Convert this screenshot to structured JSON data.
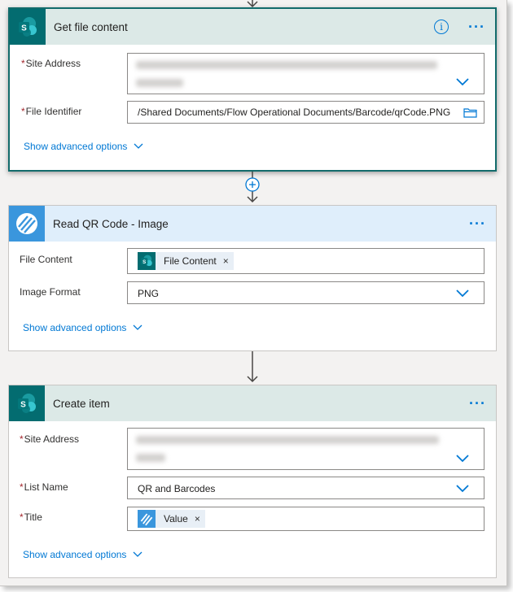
{
  "get_file_content": {
    "title": "Get file content",
    "more_icon": "more-dots-icon",
    "info_icon": "info-icon",
    "site_address": {
      "label": "Site Address",
      "required_mark": "*"
    },
    "file_identifier": {
      "label": "File Identifier",
      "required_mark": "*",
      "value": "/Shared Documents/Flow Operational Documents/Barcode/qrCode.PNG"
    },
    "advanced": "Show advanced options"
  },
  "read_qr": {
    "title": "Read QR Code - Image",
    "file_content": {
      "label": "File Content",
      "token": "File Content"
    },
    "image_format": {
      "label": "Image Format",
      "value": "PNG"
    },
    "advanced": "Show advanced options"
  },
  "create_item": {
    "title": "Create item",
    "site_address": {
      "label": "Site Address",
      "required_mark": "*"
    },
    "list_name": {
      "label": "List Name",
      "required_mark": "*",
      "value": "QR and Barcodes"
    },
    "title_field": {
      "label": "Title",
      "required_mark": "*",
      "token": "Value"
    },
    "advanced": "Show advanced options"
  },
  "token_close": "×",
  "colors": {
    "sharepoint": "#036c70",
    "qr_app": "#3a96dd",
    "accent": "#0078d4",
    "required": "#a4262c"
  }
}
